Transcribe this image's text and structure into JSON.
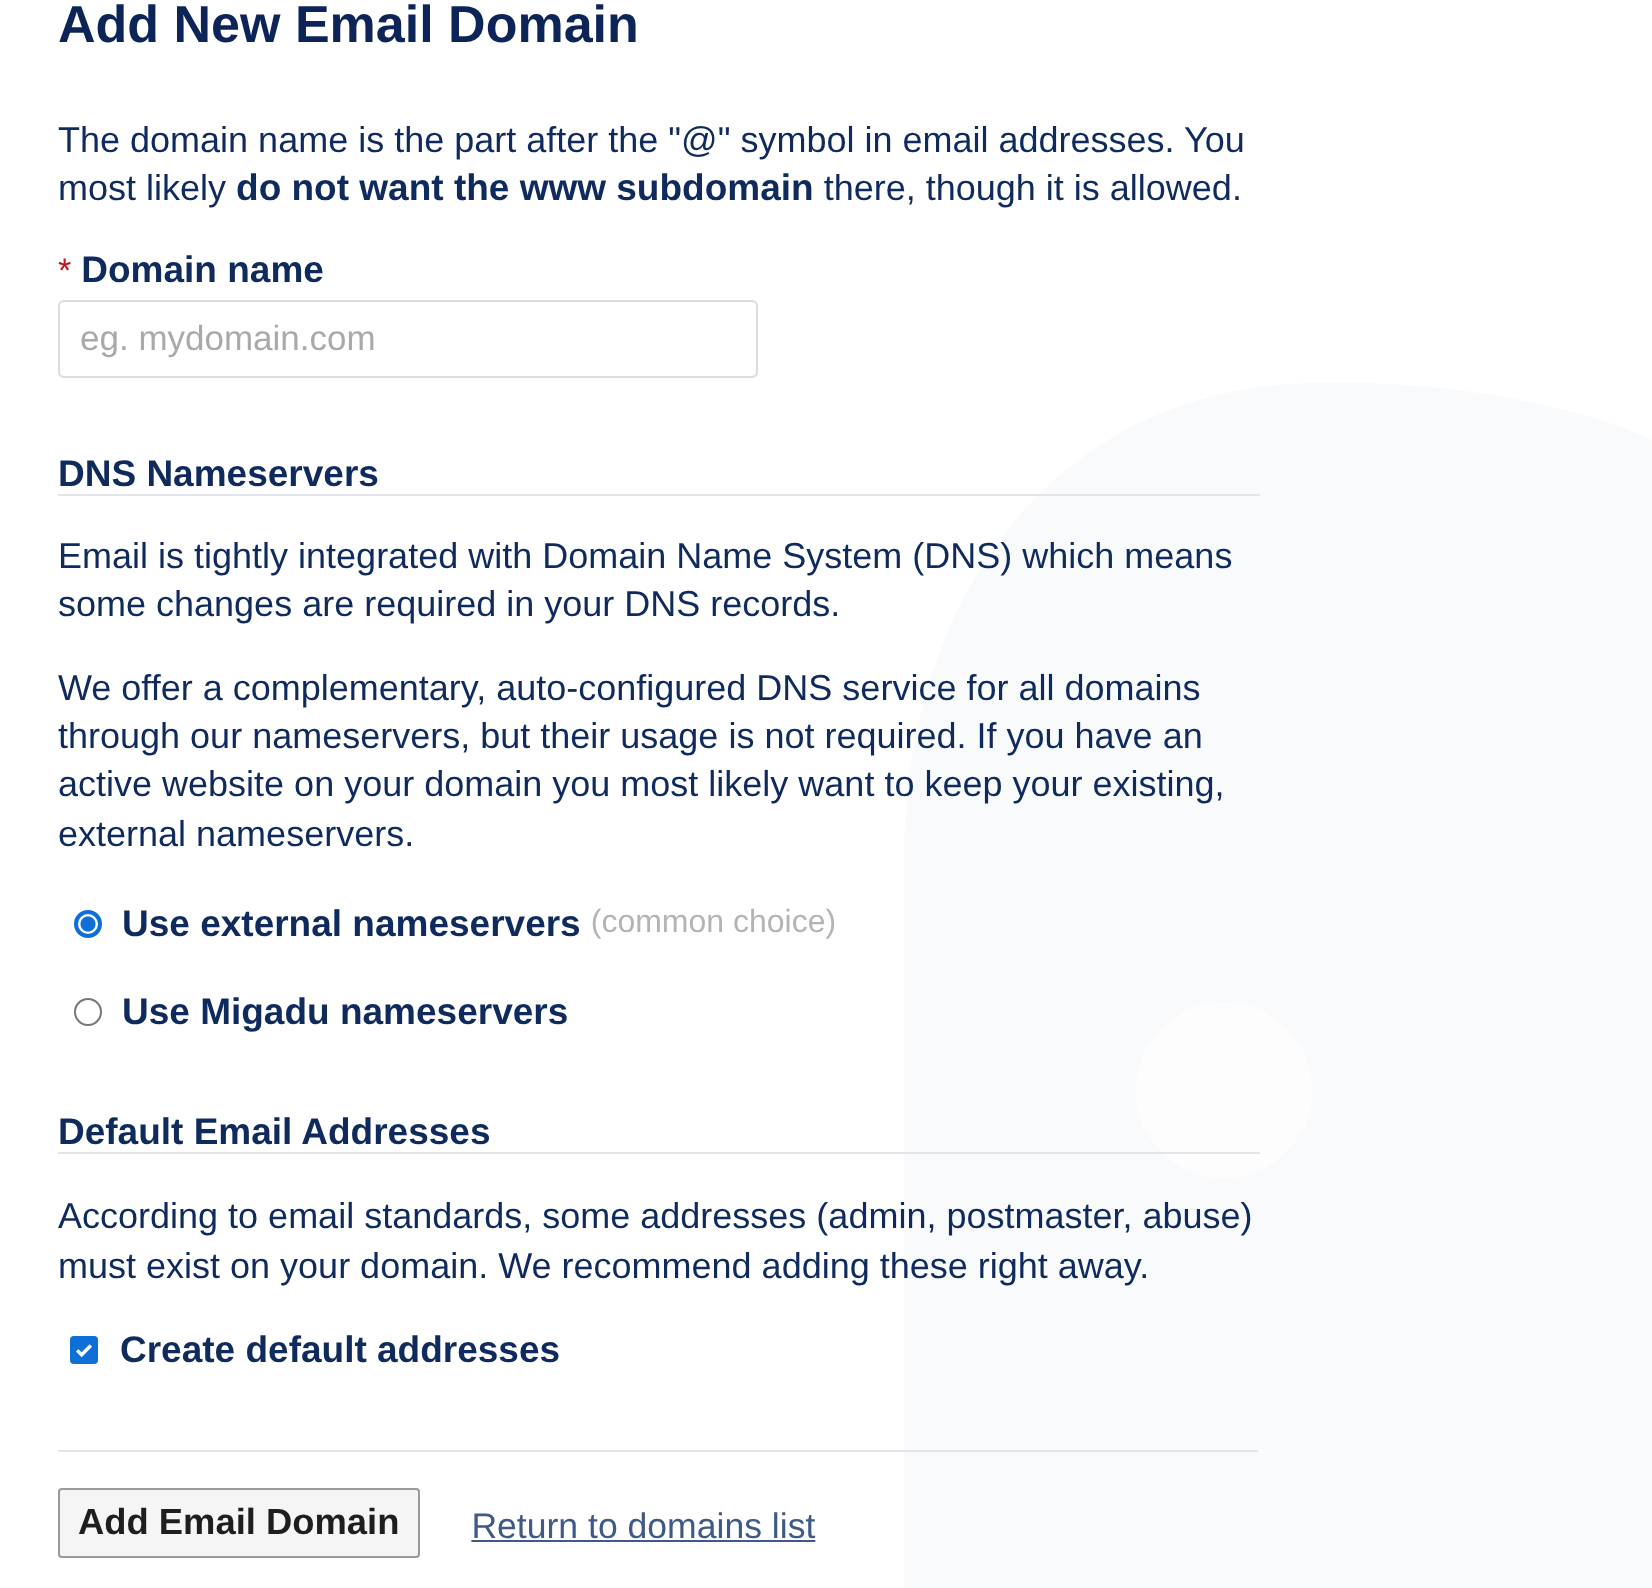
{
  "page": {
    "title": "Add New Email Domain"
  },
  "intro": "The domain name is the part after the \"@\" symbol in email addresses. You most likely **do not want the www subdomain** there, though it is allowed.",
  "domain_field": {
    "required_mark": "*",
    "label": "Domain name",
    "placeholder": "eg. mydomain.com"
  },
  "sections": [
    {
      "heading": "DNS Nameservers",
      "paragraphs": [
        "Email is tightly integrated with Domain Name System (DNS) which means some changes are required in your DNS records.",
        "We offer a complementary, auto-configured DNS service for all domains through our nameservers, but their usage is not required. If you have an active website on your domain you most likely want to keep your existing, external nameservers."
      ],
      "options": [
        {
          "kind": "radio",
          "label": "Use external nameservers",
          "note": "(common choice)",
          "selected": true
        },
        {
          "kind": "radio",
          "label": "Use Migadu nameservers",
          "selected": false
        }
      ]
    },
    {
      "heading": "Default Email Addresses",
      "paragraphs": [
        "According to email standards, some addresses (admin, postmaster, abuse) must exist on your domain. We recommend adding these right away."
      ],
      "options": [
        {
          "kind": "checkbox",
          "label": "Create default addresses",
          "checked": true
        }
      ]
    }
  ],
  "actions": {
    "submit": "Add Email Domain",
    "link": "Return to domains list"
  }
}
